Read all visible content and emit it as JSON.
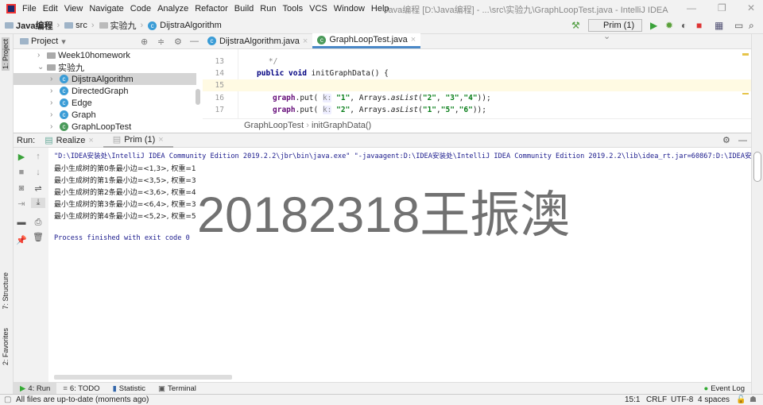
{
  "window": {
    "title": "Java编程 [D:\\Java编程] - ...\\src\\实验九\\GraphLoopTest.java - IntelliJ IDEA"
  },
  "menu": [
    "File",
    "Edit",
    "View",
    "Navigate",
    "Code",
    "Analyze",
    "Refactor",
    "Build",
    "Run",
    "Tools",
    "VCS",
    "Window",
    "Help"
  ],
  "breadcrumb": [
    "Java编程",
    "src",
    "实验九",
    "DijstraAlgorithm"
  ],
  "toolbar": {
    "run_config": "Prim (1)"
  },
  "sidebar": {
    "project_label": "1: Project",
    "structure_label": "7: Structure",
    "favorites_label": "2: Favorites"
  },
  "project": {
    "title": "Project",
    "tree": [
      {
        "label": "Week10homework",
        "type": "folder",
        "expanded": false
      },
      {
        "label": "实验九",
        "type": "folder",
        "expanded": true
      },
      {
        "label": "DijstraAlgorithm",
        "type": "class",
        "selected": true
      },
      {
        "label": "DirectedGraph",
        "type": "class"
      },
      {
        "label": "Edge",
        "type": "class"
      },
      {
        "label": "Graph",
        "type": "class"
      },
      {
        "label": "GraphLoopTest",
        "type": "class"
      }
    ]
  },
  "editor": {
    "tabs": [
      "DijstraAlgorithm.java",
      "GraphLoopTest.java"
    ],
    "active_tab": 1,
    "lines": [
      {
        "num": "13",
        "text": "    */"
      },
      {
        "num": "14",
        "text": "public void initGraphData() {"
      },
      {
        "num": "15",
        "text": ""
      },
      {
        "num": "16",
        "text": "graph.put( k: \"1\", Arrays.asList(\"2\", \"3\",\"4\"));"
      },
      {
        "num": "17",
        "text": "graph.put( k: \"2\", Arrays.asList(\"1\",\"5\",\"6\"));"
      }
    ],
    "breadcrumb": [
      "GraphLoopTest",
      "initGraphData()"
    ]
  },
  "run": {
    "label": "Run:",
    "tabs": [
      "Realize",
      "Prim (1)"
    ],
    "active_tab": 1,
    "console": [
      "\"D:\\IDEA安装处\\IntelliJ IDEA Community Edition 2019.2.2\\jbr\\bin\\java.exe\" \"-javaagent:D:\\IDEA安装处\\IntelliJ IDEA Community Edition 2019.2.2\\lib\\idea_rt.jar=60867:D:\\IDEA安装处",
      "最小生成树的第0条最小边=<1,3>, 权重=1",
      "最小生成树的第1条最小边=<3,5>, 权重=3",
      "最小生成树的第2条最小边=<3,6>, 权重=4",
      "最小生成树的第3条最小边=<6,4>, 权重=3",
      "最小生成树的第4条最小边=<5,2>, 权重=5",
      "Process finished with exit code 0"
    ]
  },
  "watermark": "20182318王振澳",
  "bottom_tabs": [
    "4: Run",
    "6: TODO",
    "Statistic",
    "Terminal"
  ],
  "event_log": "Event Log",
  "status": {
    "message": "All files are up-to-date (moments ago)",
    "position": "15:1",
    "line_sep": "CRLF",
    "encoding": "UTF-8",
    "indent": "4 spaces"
  }
}
